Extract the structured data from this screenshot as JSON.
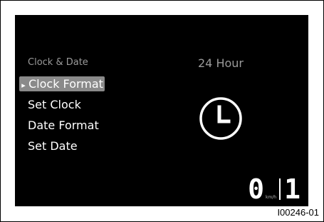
{
  "menu": {
    "header": "Clock & Date",
    "items": [
      {
        "label": "Clock Format",
        "selected": true
      },
      {
        "label": "Set Clock"
      },
      {
        "label": "Date Format"
      },
      {
        "label": "Set Date"
      }
    ],
    "selection_icon": "diamond-arrow-icon"
  },
  "detail": {
    "value": "24 Hour",
    "icon": "clock-icon"
  },
  "status": {
    "speed": "0",
    "speed_unit": "km/h",
    "gear": "1"
  },
  "figure_id": "I00246-01",
  "colors": {
    "screen_background": "#000000",
    "selection_highlight": "#8a8a8a",
    "dim_text": "#9a9a9a"
  }
}
